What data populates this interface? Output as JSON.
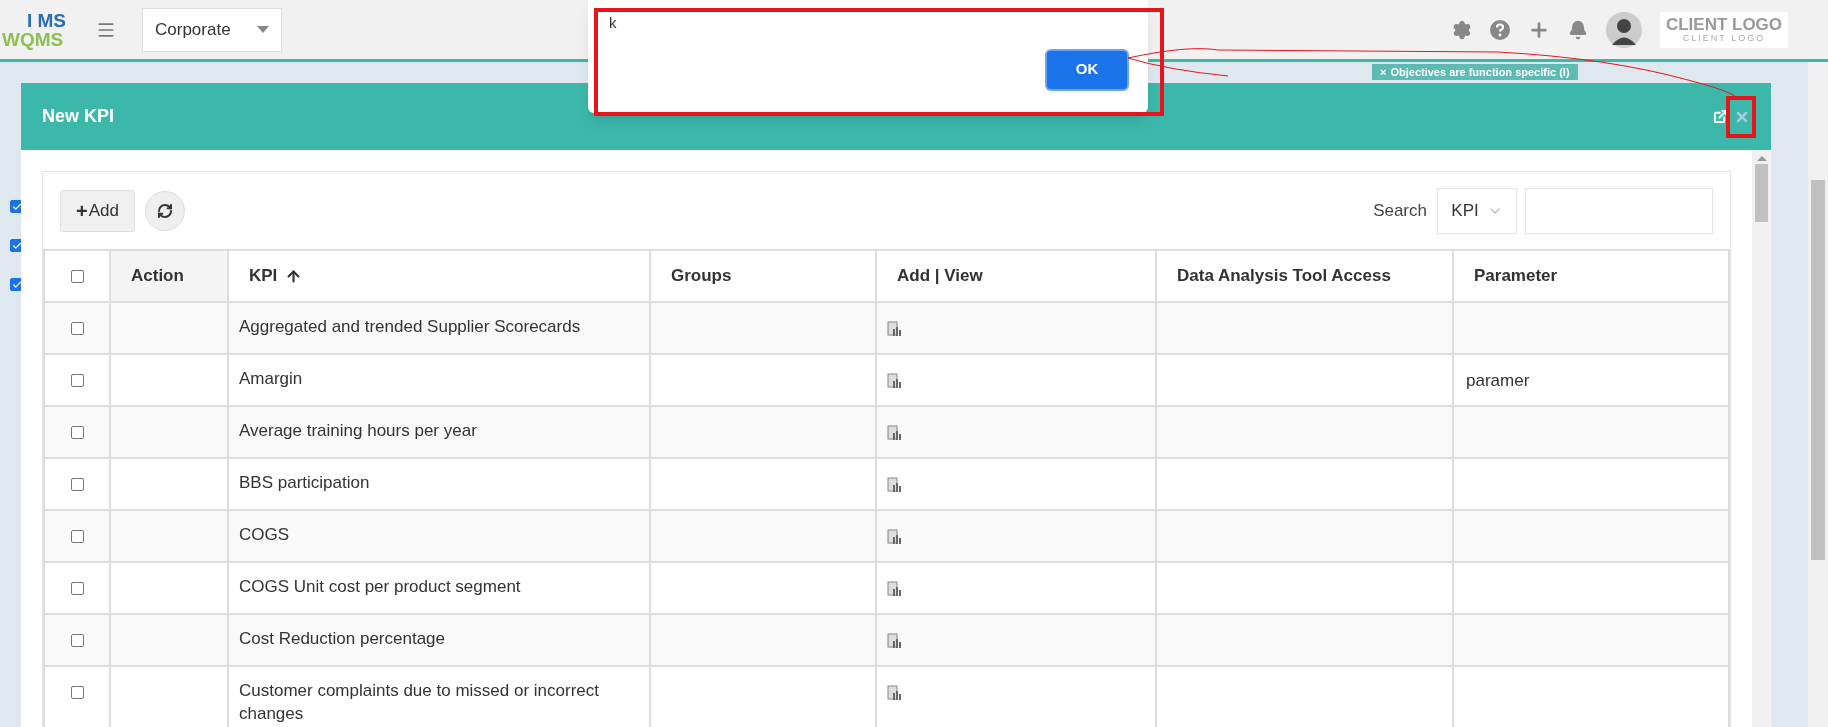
{
  "topbar": {
    "logo_top": "I MS",
    "logo_bottom": "WQMS",
    "organization": "Corporate",
    "client_logo": "CLIENT LOGO",
    "client_logo_sub": "CLIENT LOGO"
  },
  "background": {
    "tag_close": "×",
    "tag": "Objectives are function specific (I)",
    "checkboxes": [
      {
        "checked": true
      },
      {
        "checked": true
      },
      {
        "checked": true
      }
    ]
  },
  "alert": {
    "message": "k",
    "button": "OK"
  },
  "modal": {
    "title": "New KPI",
    "add_icon": "+",
    "add_button": "Add",
    "search_label": "Search",
    "search_field": "KPI",
    "all_checked": false,
    "columns": [
      {
        "label": "Action",
        "sorted": false
      },
      {
        "label": "KPI",
        "sorted": true
      },
      {
        "label": "Groups",
        "sorted": false
      },
      {
        "label": "Add | View",
        "sorted": false
      },
      {
        "label": "Data Analysis Tool Access",
        "sorted": false
      },
      {
        "label": "Parameter",
        "sorted": false
      }
    ],
    "rows": [
      {
        "checked": false,
        "kpi": "Aggregated and trended Supplier Scorecards"
      },
      {
        "checked": false,
        "kpi": "Amargin",
        "parameter": "paramer"
      },
      {
        "checked": false,
        "kpi": "Average training hours per year"
      },
      {
        "checked": false,
        "kpi": "BBS participation"
      },
      {
        "checked": false,
        "kpi": "COGS"
      },
      {
        "checked": false,
        "kpi": "COGS Unit cost per product segment"
      },
      {
        "checked": false,
        "kpi": "Cost Reduction percentage"
      },
      {
        "checked": false,
        "kpi": "Customer complaints due to missed or incorrect changes"
      }
    ]
  }
}
